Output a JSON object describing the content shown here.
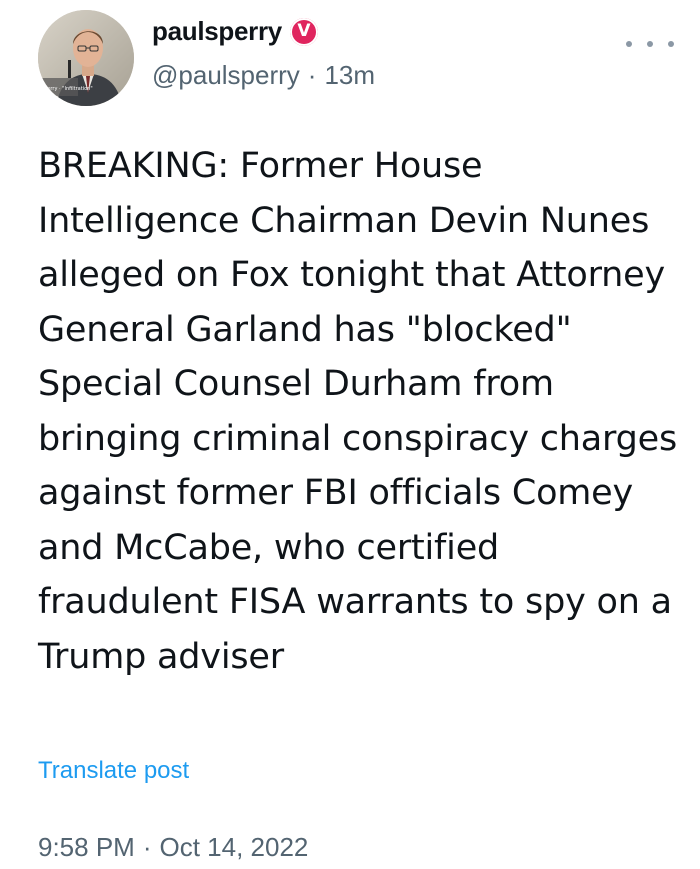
{
  "post": {
    "author": {
      "display_name": "paulsperry",
      "verified_badge_glyph": "V",
      "handle": "@paulsperry",
      "age": "13m",
      "avatar_caption": "Sperry · \"Infiltration\""
    },
    "separator": "·",
    "text": "BREAKING: Former House Intelligence Chairman Devin Nunes alleged on Fox tonight that Attorney General Garland has \"blocked\" Special Counsel Durham from bringing criminal conspiracy charges against former FBI officials Comey and McCabe, who certified fraudulent FISA warrants to spy on a Trump adviser",
    "translate_label": "Translate post",
    "time": "9:58 PM",
    "date": "Oct 14, 2022",
    "more_icon": "more-horizontal-icon"
  },
  "colors": {
    "text_primary": "#0f1419",
    "text_secondary": "#536471",
    "link": "#1d9bf0",
    "badge": "#e0245e"
  }
}
